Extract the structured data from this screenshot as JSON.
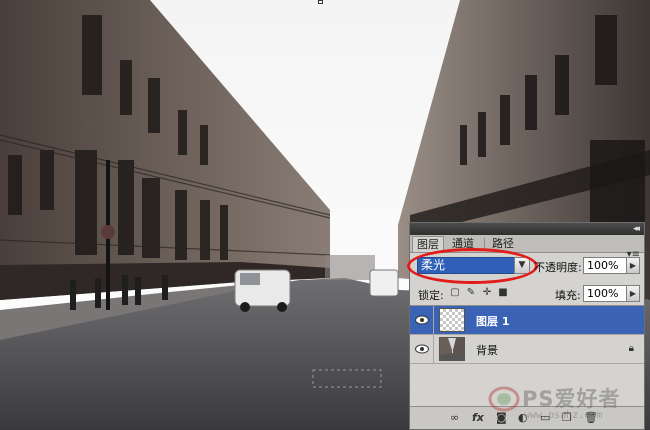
{
  "panel": {
    "tabs": [
      {
        "label": "图层",
        "active": true
      },
      {
        "label": "通道",
        "active": false
      },
      {
        "label": "路径",
        "active": false
      }
    ],
    "blend_mode": "柔光",
    "opacity_label": "不透明度:",
    "opacity_value": "100%",
    "lock_label": "锁定:",
    "fill_label": "填充:",
    "fill_value": "100%",
    "layers": [
      {
        "name": "图层 1",
        "selected": true,
        "visible": true,
        "locked": false
      },
      {
        "name": "背景",
        "selected": false,
        "visible": true,
        "locked": true
      }
    ],
    "bottom_icons": [
      "link-icon",
      "fx-icon",
      "mask-icon",
      "adjustment-icon",
      "group-icon",
      "new-layer-icon",
      "trash-icon"
    ]
  },
  "watermark": {
    "brand": "PS爱好者",
    "url": "www.psahz.com"
  },
  "colors": {
    "selection_blue": "#3a63b6",
    "highlight_red": "#e21b1b",
    "panel_gray": "#d4d3cf"
  }
}
